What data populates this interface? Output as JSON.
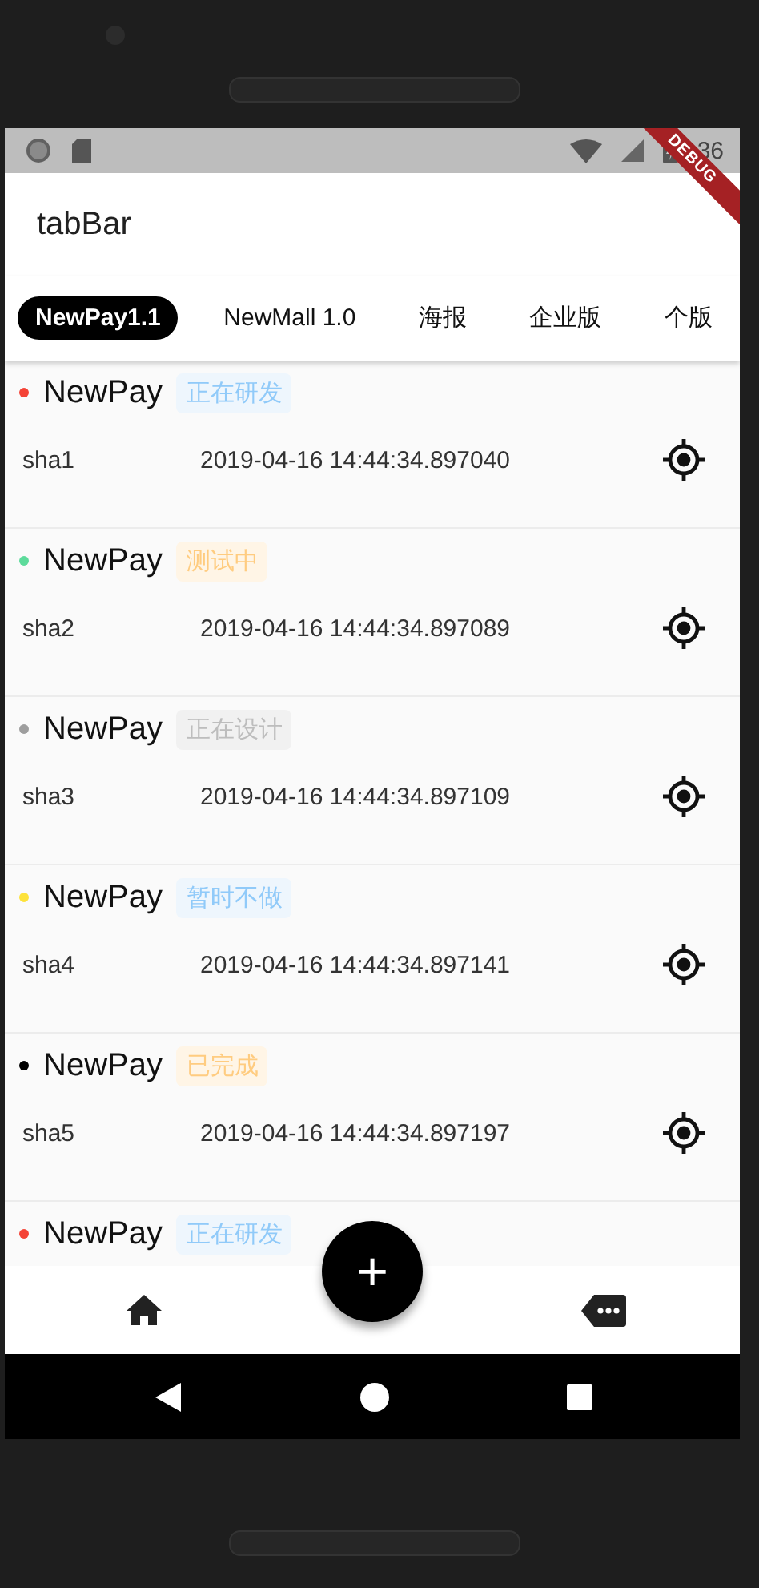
{
  "status_bar": {
    "time": "36"
  },
  "debug_banner": "DEBUG",
  "app_bar": {
    "title": "tabBar"
  },
  "tabs": [
    {
      "label": "NewPay1.1",
      "selected": true
    },
    {
      "label": "NewMall 1.0",
      "selected": false
    },
    {
      "label": "海报",
      "selected": false
    },
    {
      "label": "企业版",
      "selected": false
    },
    {
      "label": "个版",
      "selected": false
    }
  ],
  "items": [
    {
      "name": "NewPay",
      "color": "#f44336",
      "status": "正在研发",
      "kind": "blue",
      "id_text": "sha1",
      "time": "2019-04-16 14:44:34.897040"
    },
    {
      "name": "NewPay",
      "color": "#5ddb9b",
      "status": "测试中",
      "kind": "orange",
      "id_text": "sha2",
      "time": "2019-04-16 14:44:34.897089"
    },
    {
      "name": "NewPay",
      "color": "#9e9e9e",
      "status": "正在设计",
      "kind": "grey",
      "id_text": "sha3",
      "time": "2019-04-16 14:44:34.897109"
    },
    {
      "name": "NewPay",
      "color": "#fde23a",
      "status": "暂时不做",
      "kind": "blue",
      "id_text": "sha4",
      "time": "2019-04-16 14:44:34.897141"
    },
    {
      "name": "NewPay",
      "color": "#000000",
      "status": "已完成",
      "kind": "orange",
      "id_text": "sha5",
      "time": "2019-04-16 14:44:34.897197"
    },
    {
      "name": "NewPay",
      "color": "#f44336",
      "status": "正在研发",
      "kind": "blue"
    }
  ],
  "fab": {
    "label": "+"
  }
}
